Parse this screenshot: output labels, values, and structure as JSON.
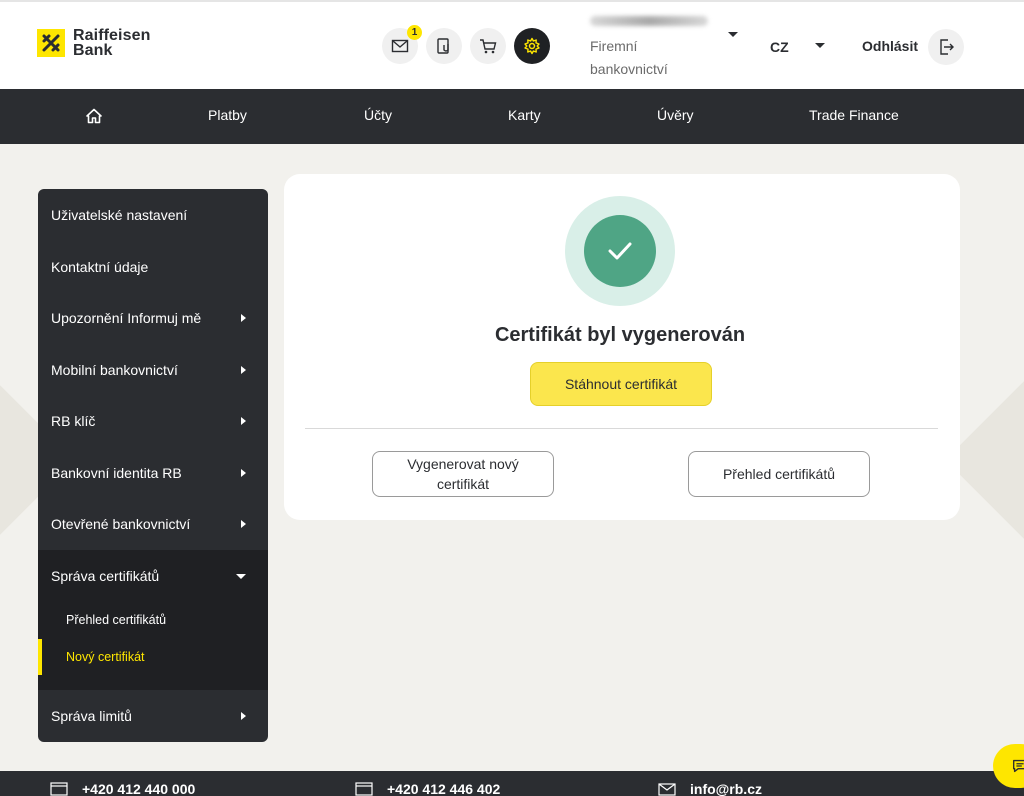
{
  "brand": {
    "name_line1": "Raiffeisen",
    "name_line2": "Bank",
    "accent_color": "#fee600"
  },
  "header": {
    "icons": [
      "mail-icon",
      "documents-icon",
      "cart-icon",
      "settings-icon"
    ],
    "mail_badge": "1",
    "account_type": "Firemní bankovnictví",
    "language": "CZ",
    "logout_label": "Odhlásit"
  },
  "nav": {
    "items": [
      "Platby",
      "Účty",
      "Karty",
      "Úvěry",
      "Trade Finance"
    ]
  },
  "sidebar": {
    "items": [
      {
        "label": "Uživatelské nastavení"
      },
      {
        "label": "Kontaktní údaje"
      },
      {
        "label": "Upozornění Informuj mě"
      },
      {
        "label": "Mobilní bankovnictví"
      },
      {
        "label": "RB klíč"
      },
      {
        "label": "Bankovní identita RB"
      },
      {
        "label": "Otevřené bankovnictví"
      },
      {
        "label": "Správa certifikátů"
      },
      {
        "label": "Správa limitů"
      }
    ],
    "sub_items": [
      {
        "label": "Přehled certifikátů"
      },
      {
        "label": "Nový certifikát"
      }
    ]
  },
  "main": {
    "title": "Certifikát byl vygenerován",
    "download_button": "Stáhnout certifikát",
    "generate_new_button": "Vygenerovat nový certifikát",
    "overview_button": "Přehled certifikátů",
    "success_color": "#4fa585"
  },
  "footer": {
    "phone1": "+420 412 440 000",
    "phone2": "+420 412 446 402",
    "email": "info@rb.cz"
  }
}
